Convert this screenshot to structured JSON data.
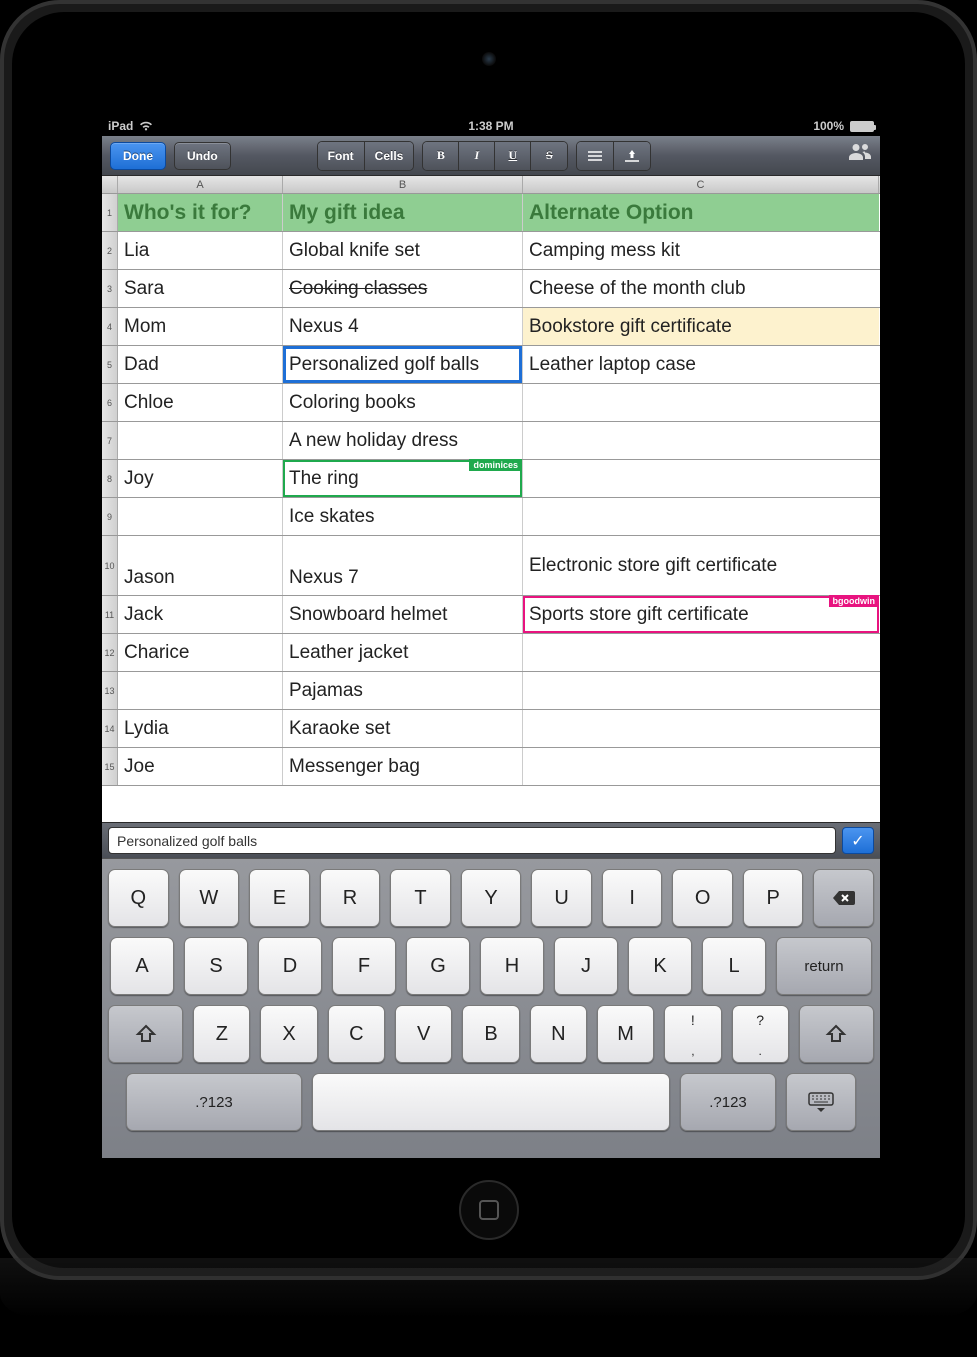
{
  "status": {
    "carrier": "iPad",
    "time": "1:38 PM",
    "battery": "100%"
  },
  "toolbar": {
    "done": "Done",
    "undo": "Undo",
    "font": "Font",
    "cells": "Cells"
  },
  "columns": [
    "A",
    "B",
    "C"
  ],
  "headers": {
    "a": "Who's it for?",
    "b": "My gift idea",
    "c": "Alternate Option"
  },
  "rows": [
    {
      "n": "1"
    },
    {
      "n": "2",
      "a": "Lia",
      "b": "Global knife set",
      "c": "Camping mess kit"
    },
    {
      "n": "3",
      "a": "Sara",
      "b": "Cooking classes",
      "c": "Cheese of the month club",
      "b_strike": true
    },
    {
      "n": "4",
      "a": "Mom",
      "b": "Nexus 4",
      "c": "Bookstore gift certificate",
      "c_hl": true
    },
    {
      "n": "5",
      "a": "Dad",
      "b": "Personalized golf balls",
      "c": "Leather laptop case",
      "b_sel": "blue"
    },
    {
      "n": "6",
      "a": "Chloe",
      "b": "Coloring books",
      "c": ""
    },
    {
      "n": "7",
      "a": "",
      "b": "A new holiday dress",
      "c": ""
    },
    {
      "n": "8",
      "a": "Joy",
      "b": "The ring",
      "c": "",
      "b_sel": "green",
      "b_tag": "dominices"
    },
    {
      "n": "9",
      "a": "",
      "b": "Ice skates",
      "c": ""
    },
    {
      "n": "10",
      "a": "Jason",
      "b": "Nexus 7",
      "c": "Electronic store gift certificate"
    },
    {
      "n": "11",
      "a": "Jack",
      "b": "Snowboard helmet",
      "c": "Sports store gift certificate",
      "c_sel": "pink",
      "c_tag": "bgoodwin"
    },
    {
      "n": "12",
      "a": "Charice",
      "b": "Leather jacket",
      "c": ""
    },
    {
      "n": "13",
      "a": "",
      "b": "Pajamas",
      "c": ""
    },
    {
      "n": "14",
      "a": "Lydia",
      "b": "Karaoke set",
      "c": ""
    },
    {
      "n": "15",
      "a": "Joe",
      "b": "Messenger bag",
      "c": ""
    }
  ],
  "formula": {
    "value": "Personalized golf balls"
  },
  "keyboard": {
    "r1": [
      "Q",
      "W",
      "E",
      "R",
      "T",
      "Y",
      "U",
      "I",
      "O",
      "P"
    ],
    "r2": [
      "A",
      "S",
      "D",
      "F",
      "G",
      "H",
      "J",
      "K",
      "L"
    ],
    "r3": [
      "Z",
      "X",
      "C",
      "V",
      "B",
      "N",
      "M"
    ],
    "punct1_top": "!",
    "punct1_bot": ",",
    "punct2_top": "?",
    "punct2_bot": ".",
    "return": "return",
    "mode": ".?123"
  }
}
